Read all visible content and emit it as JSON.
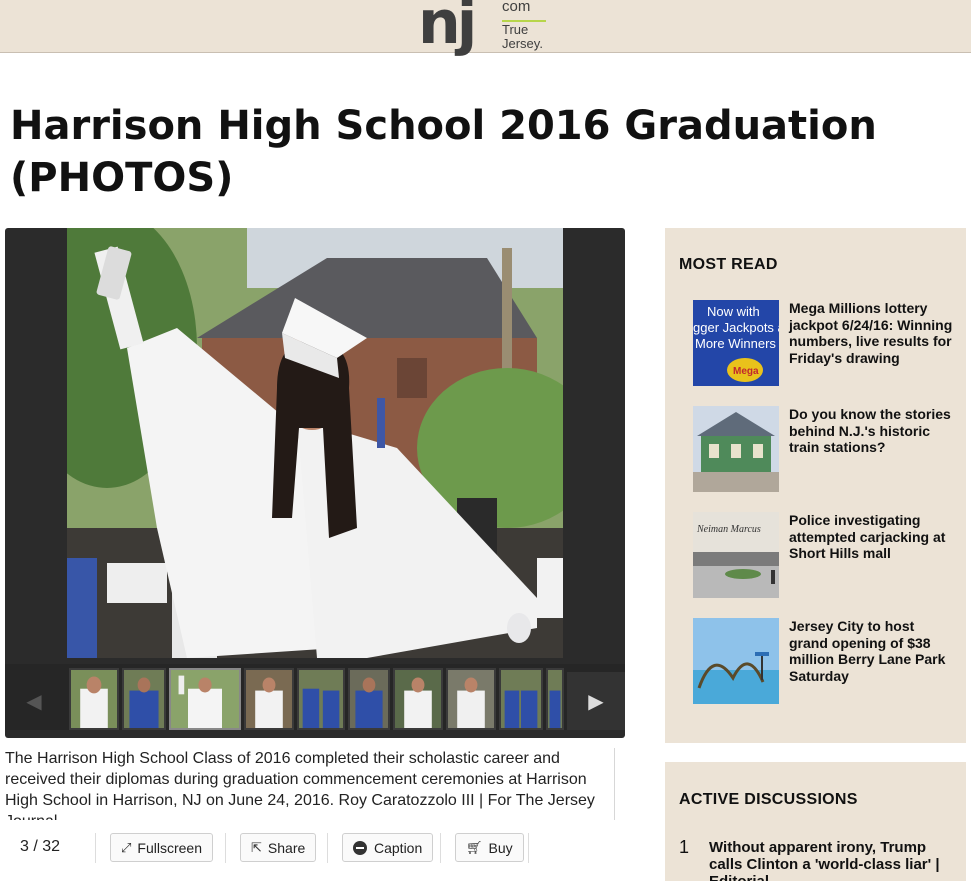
{
  "header": {
    "logo_main": "nj",
    "logo_com": "com",
    "logo_tagline": "True Jersey."
  },
  "article": {
    "title": "Harrison High School 2016 Graduation (PHOTOS)"
  },
  "gallery": {
    "caption": "The Harrison High School Class of 2016 completed their scholastic career and received their diplomas during graduation commencement ceremonies at Harrison High School in Harrison, NJ on June 24, 2016. Roy Caratozzolo III | For The Jersey Journal",
    "counter": "3 / 32",
    "prev_arrow": "◀",
    "next_arrow": "▶",
    "buttons": {
      "fullscreen": "Fullscreen",
      "share": "Share",
      "caption": "Caption",
      "buy": "Buy"
    }
  },
  "most_read": {
    "title": "MOST READ",
    "items": [
      {
        "headline": "Mega Millions lottery jackpot 6/24/16: Winning numbers, live results for Friday's drawing",
        "thumb_text": "Now with gger Jackpots a More Winners"
      },
      {
        "headline": "Do you know the stories behind N.J.'s historic train stations?"
      },
      {
        "headline": "Police investigating attempted carjacking at Short Hills mall",
        "thumb_text": "Neiman Marcus"
      },
      {
        "headline": "Jersey City to host grand opening of $38 million Berry Lane Park Saturday"
      }
    ]
  },
  "active_discussions": {
    "title": "ACTIVE DISCUSSIONS",
    "items": [
      {
        "number": "1",
        "headline": "Without apparent irony, Trump calls Clinton a 'world-class liar' | Editorial"
      }
    ]
  }
}
